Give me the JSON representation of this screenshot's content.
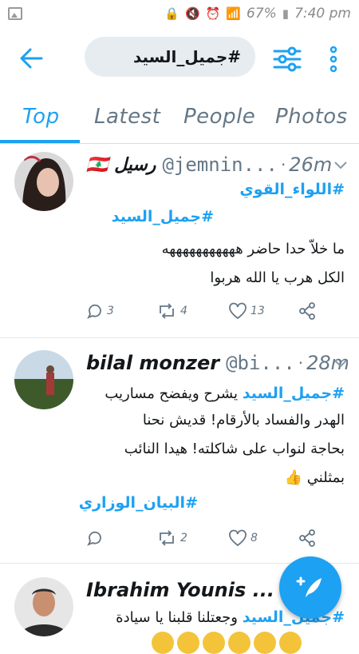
{
  "status_bar": {
    "battery": "67%",
    "time": "7:40 pm"
  },
  "search": {
    "query": "#جميل_السيد"
  },
  "tabs": [
    {
      "label": "Top",
      "active": true
    },
    {
      "label": "Latest",
      "active": false
    },
    {
      "label": "People",
      "active": false
    },
    {
      "label": "Photos",
      "active": false
    }
  ],
  "colors": {
    "accent": "#1da1f2",
    "secondary_text": "#657786",
    "search_bg": "#e6ecf0"
  },
  "tweets": [
    {
      "name": "رسيل 🇱🇧",
      "handle": "@jemnin...",
      "time": "26m",
      "hashtag1": "#اللواء_القوي",
      "hashtag2": "#جميل_السيد",
      "line1": "ما خلاّ حدا حاضر هههههههههههه",
      "line2": "الكل هرب  يا الله هربوا",
      "replies": "3",
      "retweets": "4",
      "likes": "13"
    },
    {
      "name": "bilal monzer",
      "handle": "@bi...",
      "time": "28m",
      "hashtag_inline": "#جميل_السيد",
      "line1_rest": " يشرح ويفضح مساريب",
      "line2": "الهدر والفساد بالأرقام! قديش نحنا",
      "line3": "بحاجة لنواب على شاكلته! هيدا النائب",
      "line4": "بمثلني 👍",
      "hashtag_end": "#البيان_الوزاري",
      "replies": "",
      "retweets": "2",
      "likes": "8"
    },
    {
      "name": "Ibrahim Younis ...",
      "hashtag_inline": "#جميل_السيد",
      "line1_rest": " وجعتلنا قلبنا يا سيادة"
    }
  ],
  "icons": {
    "back": "arrow-left-icon",
    "filter": "sliders-icon",
    "more": "vertical-dots-icon",
    "compose": "feather-plus-icon"
  }
}
